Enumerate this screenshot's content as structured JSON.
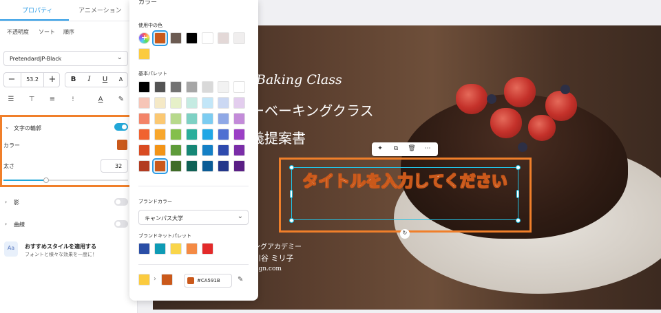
{
  "panel": {
    "tabs": [
      {
        "label": "プロパティ"
      },
      {
        "label": "アニメーション"
      }
    ],
    "subtabs": [
      {
        "label": "不透明度"
      },
      {
        "label": "ソート"
      },
      {
        "label": "順序"
      }
    ],
    "font_family": "PretendardJP-Black",
    "font_size": "53.2",
    "style_buttons": [
      "B",
      "I",
      "U",
      "A"
    ],
    "outline": {
      "title": "文字の輪郭",
      "enabled": true,
      "color_label": "カラー",
      "color": "#CA591B",
      "width_label": "太さ",
      "width_value": "32",
      "slider": 0.34
    },
    "shadow": {
      "title": "影",
      "enabled": false
    },
    "curve": {
      "title": "曲線",
      "enabled": false
    },
    "recommend": {
      "title": "おすすめスタイルを適用する",
      "subtitle": "フォントと様々な効果を一度に！"
    }
  },
  "popup": {
    "title": "カラー",
    "used_title": "使用中の色",
    "used_colors": [
      "#CA591B",
      "#6B5B52",
      "#000000",
      "#FFFFFF",
      "#E3D8D7",
      "#F0EEEE",
      "#FBCB3F"
    ],
    "basic_title": "基本パレット",
    "basic_palette": [
      [
        "#000000",
        "#545454",
        "#737373",
        "#A6A6A6",
        "#D9D9D9",
        "#F2F2F2",
        "#FFFFFF"
      ],
      [
        "#F6C5B7",
        "#F5E9C6",
        "#E6F0C8",
        "#C5EBE2",
        "#C2E6F8",
        "#CBD8F3",
        "#E3CDEE"
      ],
      [
        "#F38469",
        "#FBC872",
        "#B7D98C",
        "#7ED1C4",
        "#7CCCF1",
        "#8FA8E6",
        "#C38BD9"
      ],
      [
        "#F06230",
        "#F8A72C",
        "#84BF4B",
        "#2BAE9B",
        "#20A7E6",
        "#4F6FD2",
        "#9B3FC5"
      ],
      [
        "#D94B22",
        "#F39417",
        "#5E9B3A",
        "#168776",
        "#1480C6",
        "#2E4AAE",
        "#7A2DA8"
      ],
      [
        "#B23B21",
        "#CA591B",
        "#3F6C28",
        "#0F6055",
        "#0B5C96",
        "#23368A",
        "#5A1F85"
      ]
    ],
    "brand_title": "ブランドカラー",
    "brand_value": "キャンパス大学",
    "brand_kit_title": "ブランドキットパレット",
    "brand_kit": [
      "#2A4EA6",
      "#0E9BB5",
      "#F9D54A",
      "#F48A44",
      "#E32A2A"
    ],
    "from_color": "#FBCB3F",
    "to_color": "#CA591B",
    "hex_value": "#CA591B"
  },
  "canvas": {
    "script_title": "Baking Class",
    "line1": "ーベーキングクラス",
    "line2": "義提案書",
    "title_text": "タイトルを入力してください",
    "footer1": "ングアカデミー",
    "footer2": "川谷 ミリ子",
    "footer3": "sign.com"
  }
}
